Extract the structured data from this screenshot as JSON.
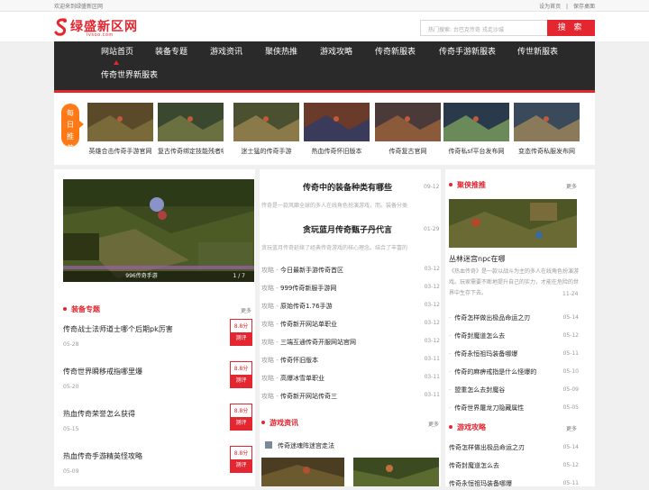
{
  "topbar": {
    "welcome": "欢迎来到绿盛新区网",
    "set_home": "设为首页",
    "sep": "|",
    "save_desktop": "保存桌面"
  },
  "brand": {
    "name": "绿盛新区网",
    "domain": "lvsoo.com",
    "color": "#e3262f"
  },
  "search": {
    "placeholder": "热门搜索: 台巴克传奇 戎走沙城",
    "button": "搜 索",
    "icon": "search-icon"
  },
  "nav": {
    "row1": [
      "网站首页",
      "装备专题",
      "游戏资讯",
      "聚侠热推",
      "游戏攻略",
      "传奇新服表",
      "传奇手游新服表",
      "传世新服表"
    ],
    "row2": [
      "传奇世界新服表"
    ],
    "active": "网站首页"
  },
  "daily": {
    "tag": [
      "每",
      "日",
      "推",
      "荐"
    ],
    "items": [
      "英雄合击传奇手游官网",
      "复古传奇绑定技能残者哪",
      "迷士猛的传奇手游",
      "热血传奇怀旧版本",
      "传奇复古官网",
      "传奇私sf平台发布网",
      "变态传奇私服发布网"
    ]
  },
  "slider": {
    "caption": "996传奇手游",
    "counter": "1 / 7"
  },
  "equip": {
    "title": "装备专题",
    "more": "更多",
    "items": [
      {
        "title": "传奇战士法师道士哪个后期pk厉害",
        "date": "05-28",
        "score": "8.8分",
        "btn": "测评"
      },
      {
        "title": "传奇世界瞬移戒指哪里爆",
        "date": "05-20",
        "score": "8.8分",
        "btn": "测评"
      },
      {
        "title": "热血传奇荣誉怎么获得",
        "date": "05-15",
        "score": "8.8分",
        "btn": "测评"
      },
      {
        "title": "热血传奇手游精英怪攻略",
        "date": "05-09",
        "score": "8.8分",
        "btn": "测评"
      }
    ]
  },
  "middle": {
    "headline1": {
      "title": "传奇中的装备种类有哪些",
      "date": "09-12",
      "summary": "传奇是一款风靡全球的多人在线角色扮演游戏，而。装备分类"
    },
    "headline2": {
      "title": "贪玩蓝月传奇甄子丹代言",
      "date": "01-29",
      "summary": "贪玩蓝月传奇延续了经典传奇游戏的核心理念。结合了丰富的"
    },
    "prefix": "攻略 -",
    "list": [
      {
        "title": "今日最新手游传奇首区",
        "date": "03-12"
      },
      {
        "title": "999传奇新服手游网",
        "date": "03-12"
      },
      {
        "title": "原始传奇1.76手游",
        "date": "03-12"
      },
      {
        "title": "传奇新开网站单职业",
        "date": "03-12"
      },
      {
        "title": "三端互通传奇开服网站官网",
        "date": "03-12"
      },
      {
        "title": "传奇怀旧版本",
        "date": "03-11"
      },
      {
        "title": "高爆冰雪单职业",
        "date": "03-11"
      },
      {
        "title": "传奇新开网站传奇三",
        "date": "03-11"
      }
    ],
    "news": {
      "title": "游戏资讯",
      "more": "更多",
      "first": "传奇迷魂阵迷宫走法"
    }
  },
  "right": {
    "hot": {
      "title": "聚侠推推",
      "more": "更多",
      "pic_title": "丛林迷宫npc在哪",
      "summary": "《热血传奇》是一款以战斗为主的多人在线角色扮演游戏。玩家需要不断地提升自己的实力，才能在危险的世界中生存下去。",
      "summary_date": "11-24"
    },
    "list": [
      {
        "title": "传奇怎样做出极品命运之刃",
        "date": "05-14"
      },
      {
        "title": "传奇封魔道怎么去",
        "date": "05-12"
      },
      {
        "title": "传奇永恒祖玛装备哪爆",
        "date": "05-11"
      },
      {
        "title": "传奇的麻痹戒指是什么怪爆的",
        "date": "05-10"
      },
      {
        "title": "盟重怎么去封魔谷",
        "date": "05-09"
      },
      {
        "title": "传奇世界屠龙刀隐藏属性",
        "date": "05-05"
      }
    ],
    "guide": {
      "title": "游戏攻略",
      "more": "更多"
    },
    "guide_list": [
      {
        "title": "传奇怎样做出极品命运之刃",
        "date": "05-14"
      },
      {
        "title": "传奇封魔道怎么去",
        "date": "05-12"
      },
      {
        "title": "传奇永恒祖玛装备哪爆",
        "date": "05-11"
      }
    ]
  }
}
